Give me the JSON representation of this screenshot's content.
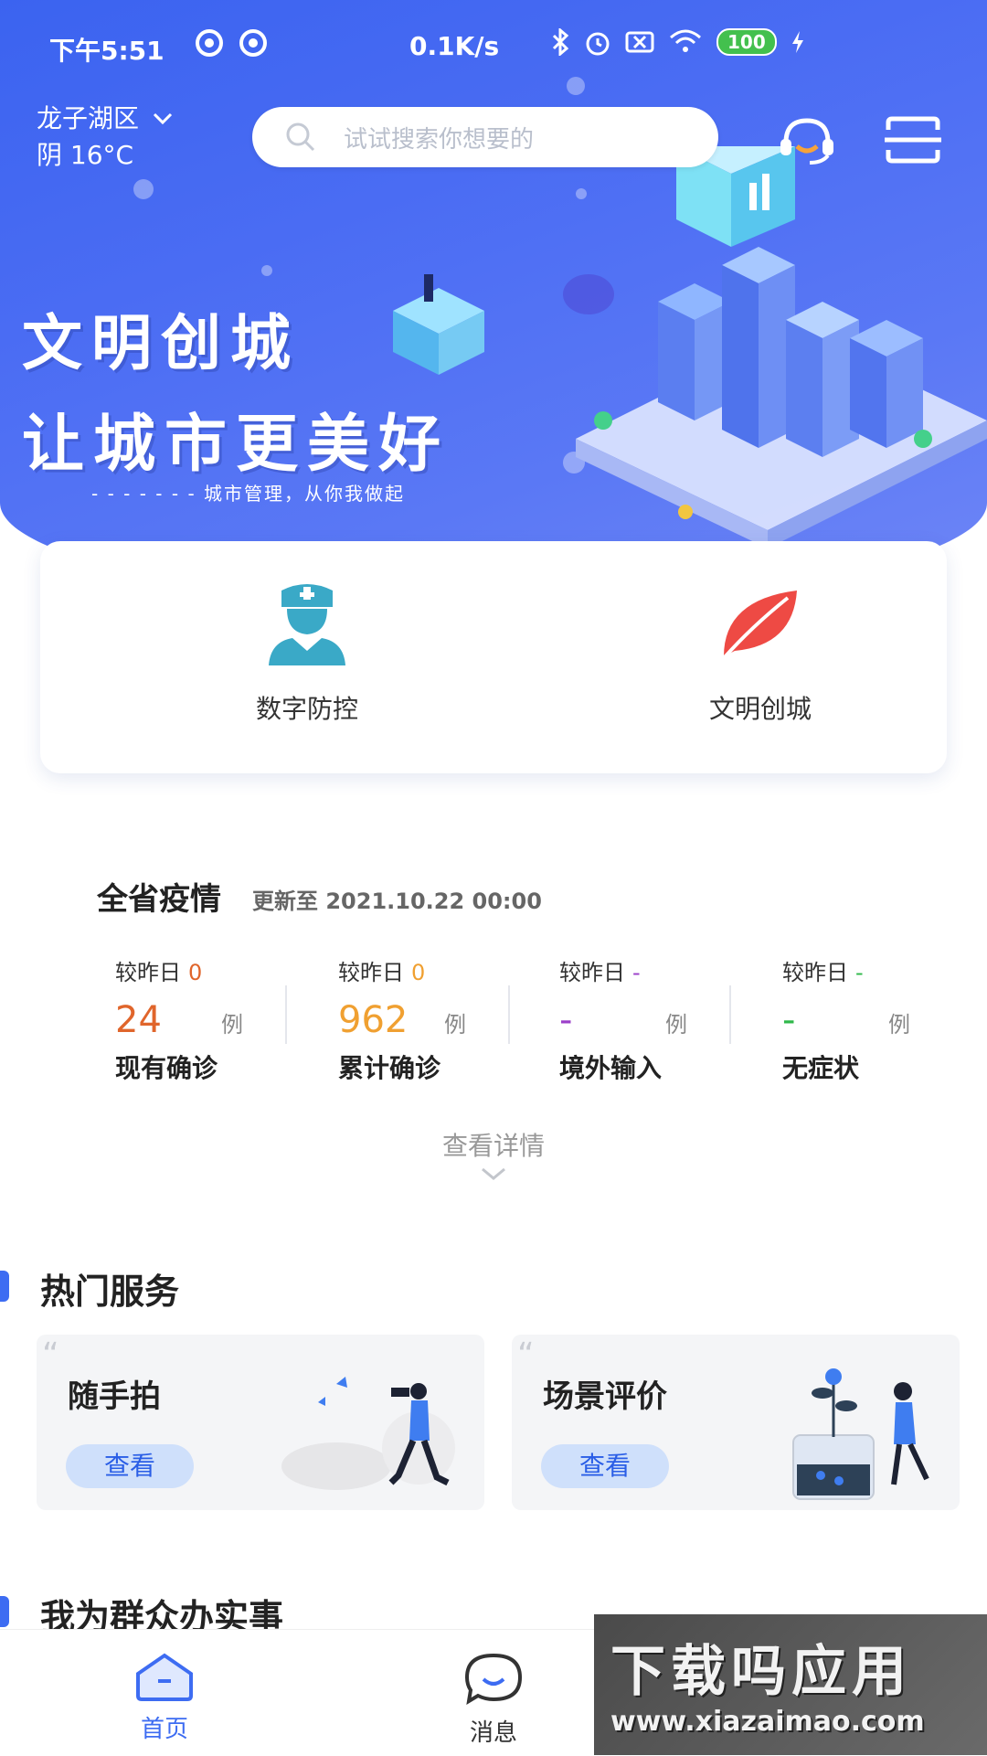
{
  "status_bar": {
    "time": "下午5:51",
    "net_speed": "0.1K/s",
    "battery": "100"
  },
  "header": {
    "district": "龙子湖区",
    "weather": "阴 16°C",
    "search_placeholder": "试试搜索你想要的"
  },
  "banner": {
    "line1": "文明创城",
    "line2": "让城市更美好",
    "line3": "- - - - - - -   城市管理，从你我做起"
  },
  "quick_entries": [
    {
      "label": "数字防控",
      "icon": "nurse-icon"
    },
    {
      "label": "文明创城",
      "icon": "leaf-icon"
    }
  ],
  "epidemic": {
    "title": "全省疫情",
    "updated": "更新至 2021.10.22 00:00",
    "compare_label": "较昨日",
    "unit": "例",
    "stats": [
      {
        "delta": "0",
        "value": "24",
        "name": "现有确诊",
        "color": "#e0652b"
      },
      {
        "delta": "0",
        "value": "962",
        "name": "累计确诊",
        "color": "#f0a031"
      },
      {
        "delta": "-",
        "value": "-",
        "name": "境外输入",
        "color": "#9b3fc9"
      },
      {
        "delta": "-",
        "value": "-",
        "name": "无症状",
        "color": "#2fb84a"
      }
    ],
    "details_label": "查看详情"
  },
  "hot_services": {
    "title": "热门服务",
    "items": [
      {
        "title": "随手拍",
        "button": "查看"
      },
      {
        "title": "场景评价",
        "button": "查看"
      }
    ]
  },
  "next_section": {
    "title": "我为群众办实事"
  },
  "bottom_nav": [
    {
      "label": "首页",
      "active": true
    },
    {
      "label": "消息",
      "active": false
    }
  ],
  "watermark": {
    "big": "下载吗应用",
    "small": "www.xiazaimao.com"
  },
  "colors": {
    "accent": "#3d6cf2",
    "nav_active": "#3d6cf2"
  }
}
